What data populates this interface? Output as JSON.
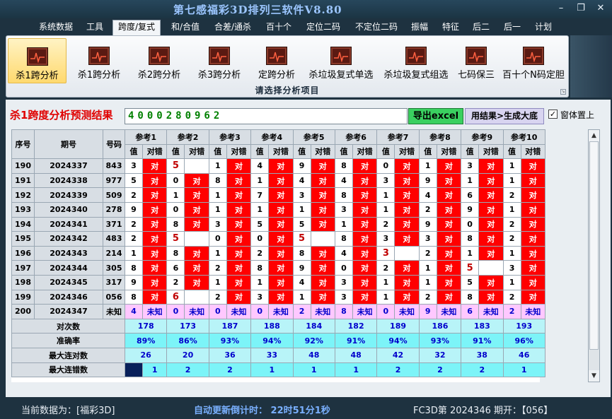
{
  "window": {
    "title": "第七感福彩3D排列三软件V8.80",
    "minimize_glyph": "–",
    "restore_glyph": "❐",
    "close_glyph": "✕"
  },
  "menu": [
    {
      "label": "系统数据"
    },
    {
      "label": "工具"
    },
    {
      "label": "跨度/复式",
      "active": true
    },
    {
      "label": "和/合值"
    },
    {
      "label": "合差/通杀"
    },
    {
      "label": "百十个"
    },
    {
      "label": "定位二码"
    },
    {
      "label": "不定位二码"
    },
    {
      "label": "振幅"
    },
    {
      "label": "特征"
    },
    {
      "label": "后二"
    },
    {
      "label": "后一"
    },
    {
      "label": "计划"
    }
  ],
  "ribbon": {
    "caption": "请选择分析项目",
    "tools": [
      {
        "label": "杀1跨分析",
        "active": true
      },
      {
        "label": "杀1跨分析"
      },
      {
        "label": "杀2跨分析"
      },
      {
        "label": "杀3跨分析"
      },
      {
        "label": "定跨分析"
      },
      {
        "label": "杀垃圾复式单选"
      },
      {
        "label": "杀垃圾复式组选"
      },
      {
        "label": "七码保三"
      },
      {
        "label": "百十个N码定胆"
      }
    ]
  },
  "result": {
    "title": "杀1跨度分析预测结果",
    "value": "4000280962",
    "excel_button": "导出excel",
    "gen_button": "用结果>生成大底",
    "pin_checkbox_label": "窗体置上",
    "pin_checked": true
  },
  "table": {
    "headers": {
      "seq": "序号",
      "period": "期号",
      "number": "号码",
      "value": "值",
      "judge": "对错"
    },
    "refs": [
      "参考1",
      "参考2",
      "参考3",
      "参考4",
      "参考5",
      "参考6",
      "参考7",
      "参考8",
      "参考9",
      "参考10"
    ],
    "correct_mark": "对",
    "rows": [
      {
        "seq": "190",
        "period": "2024337",
        "num": "843",
        "v": [
          "3",
          "5",
          "1",
          "4",
          "9",
          "8",
          "0",
          "1",
          "3",
          "1"
        ],
        "c": [
          1,
          0,
          1,
          1,
          1,
          1,
          1,
          1,
          1,
          1
        ],
        "hl": [
          0,
          1,
          0,
          0,
          0,
          0,
          0,
          0,
          0,
          0
        ]
      },
      {
        "seq": "191",
        "period": "2024338",
        "num": "977",
        "v": [
          "5",
          "0",
          "8",
          "1",
          "4",
          "4",
          "3",
          "9",
          "1",
          "1"
        ],
        "c": [
          1,
          1,
          1,
          1,
          1,
          1,
          1,
          1,
          1,
          1
        ],
        "hl": [
          0,
          0,
          0,
          0,
          0,
          0,
          0,
          0,
          0,
          0
        ]
      },
      {
        "seq": "192",
        "period": "2024339",
        "num": "509",
        "v": [
          "2",
          "1",
          "1",
          "7",
          "3",
          "8",
          "1",
          "4",
          "6",
          "2"
        ],
        "c": [
          1,
          1,
          1,
          1,
          1,
          1,
          1,
          1,
          1,
          1
        ],
        "hl": [
          0,
          0,
          0,
          0,
          0,
          0,
          0,
          0,
          0,
          0
        ]
      },
      {
        "seq": "193",
        "period": "2024340",
        "num": "278",
        "v": [
          "9",
          "0",
          "1",
          "1",
          "1",
          "3",
          "1",
          "2",
          "9",
          "1"
        ],
        "c": [
          1,
          1,
          1,
          1,
          1,
          1,
          1,
          1,
          1,
          1
        ],
        "hl": [
          0,
          0,
          0,
          0,
          0,
          0,
          0,
          0,
          0,
          0
        ]
      },
      {
        "seq": "194",
        "period": "2024341",
        "num": "371",
        "v": [
          "2",
          "8",
          "3",
          "5",
          "5",
          "1",
          "2",
          "9",
          "0",
          "2"
        ],
        "c": [
          1,
          1,
          1,
          1,
          1,
          1,
          1,
          1,
          1,
          1
        ],
        "hl": [
          0,
          0,
          0,
          0,
          0,
          0,
          0,
          0,
          0,
          0
        ]
      },
      {
        "seq": "195",
        "period": "2024342",
        "num": "483",
        "v": [
          "2",
          "5",
          "0",
          "0",
          "5",
          "8",
          "3",
          "3",
          "8",
          "2"
        ],
        "c": [
          1,
          0,
          1,
          1,
          0,
          1,
          1,
          1,
          1,
          1
        ],
        "hl": [
          0,
          1,
          0,
          0,
          1,
          0,
          0,
          0,
          0,
          0
        ]
      },
      {
        "seq": "196",
        "period": "2024343",
        "num": "214",
        "v": [
          "1",
          "8",
          "1",
          "2",
          "8",
          "4",
          "3",
          "2",
          "1",
          "1"
        ],
        "c": [
          1,
          1,
          1,
          1,
          1,
          1,
          0,
          1,
          1,
          1
        ],
        "hl": [
          0,
          0,
          0,
          0,
          0,
          0,
          1,
          0,
          0,
          0
        ]
      },
      {
        "seq": "197",
        "period": "2024344",
        "num": "305",
        "v": [
          "8",
          "6",
          "2",
          "8",
          "9",
          "0",
          "2",
          "1",
          "5",
          "3"
        ],
        "c": [
          1,
          1,
          1,
          1,
          1,
          1,
          1,
          1,
          0,
          1
        ],
        "hl": [
          0,
          0,
          0,
          0,
          0,
          0,
          0,
          0,
          1,
          0
        ]
      },
      {
        "seq": "198",
        "period": "2024345",
        "num": "317",
        "v": [
          "9",
          "2",
          "1",
          "1",
          "4",
          "3",
          "1",
          "1",
          "5",
          "1"
        ],
        "c": [
          1,
          1,
          1,
          1,
          1,
          1,
          1,
          1,
          1,
          1
        ],
        "hl": [
          0,
          0,
          0,
          0,
          0,
          0,
          0,
          0,
          0,
          0
        ]
      },
      {
        "seq": "199",
        "period": "2024346",
        "num": "056",
        "v": [
          "8",
          "6",
          "2",
          "3",
          "1",
          "3",
          "1",
          "2",
          "8",
          "2"
        ],
        "c": [
          1,
          0,
          1,
          1,
          1,
          1,
          1,
          1,
          1,
          1
        ],
        "hl": [
          0,
          1,
          0,
          0,
          0,
          0,
          0,
          0,
          0,
          0
        ]
      }
    ],
    "last_row": {
      "seq": "200",
      "period": "2024347",
      "num": "未知",
      "v": [
        "4",
        "0",
        "0",
        "0",
        "2",
        "8",
        "0",
        "9",
        "6",
        "2"
      ],
      "judge": "未知"
    },
    "stats": [
      {
        "label": "对次数",
        "values": [
          "178",
          "173",
          "187",
          "188",
          "184",
          "182",
          "189",
          "186",
          "183",
          "193"
        ]
      },
      {
        "label": "准确率",
        "values": [
          "89%",
          "86%",
          "93%",
          "94%",
          "92%",
          "91%",
          "94%",
          "93%",
          "91%",
          "96%"
        ]
      },
      {
        "label": "最大连对数",
        "values": [
          "26",
          "20",
          "36",
          "33",
          "48",
          "48",
          "42",
          "32",
          "38",
          "46"
        ]
      },
      {
        "label": "最大连错数",
        "values": [
          "1",
          "2",
          "2",
          "1",
          "1",
          "1",
          "2",
          "2",
          "2",
          "1"
        ]
      }
    ]
  },
  "status": {
    "current": "当前数据为：[福彩3D]",
    "countdown": "自动更新倒计时：  22时51分1秒",
    "latest": "FC3D第 2024346 期开：【056】"
  },
  "colors": {
    "correct": "#ff0000",
    "wrong_text": "#c00000",
    "unknown_row": "#ffc8ff",
    "stat_bg": "#b8f4f8",
    "accent_green": "#3ad060"
  }
}
